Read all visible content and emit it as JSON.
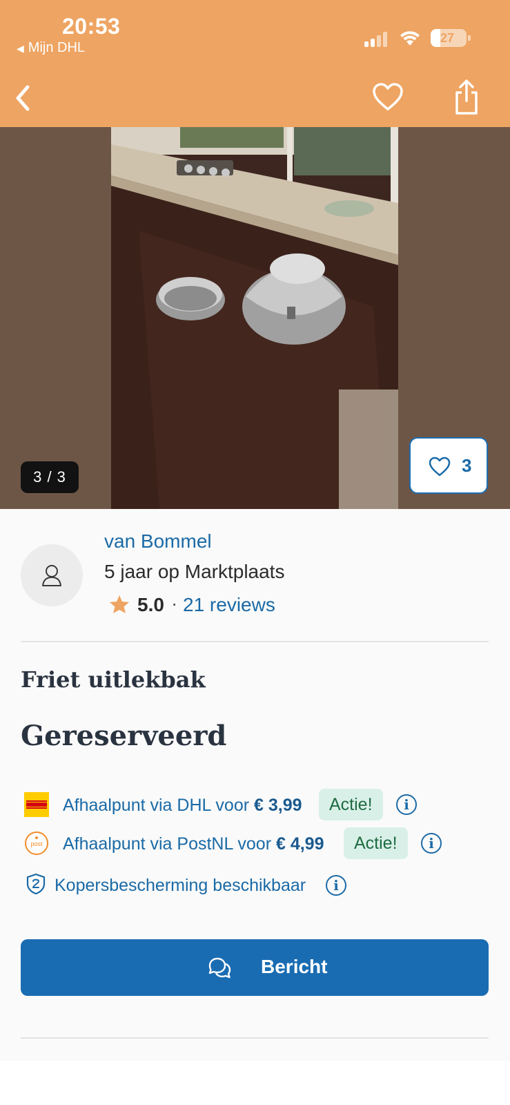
{
  "status_bar": {
    "time": "20:53",
    "back_app_label": "Mijn DHL",
    "battery": "27"
  },
  "header": {
    "back_icon": "chevron-left-icon",
    "favorite_icon": "heart-outline-icon",
    "share_icon": "share-icon",
    "bg_color": "#eea462"
  },
  "gallery": {
    "counter": "3 / 3",
    "favorites_count": "3"
  },
  "seller": {
    "name": "van Bommel",
    "years_label": "5 jaar op Marktplaats",
    "rating": "5.0",
    "separator": "·",
    "reviews": "21 reviews"
  },
  "listing": {
    "title": "Friet uitlekbak",
    "status": "Gereserveerd"
  },
  "shipping": [
    {
      "carrier_icon": "dhl-logo-icon",
      "text": "Afhaalpunt via DHL voor ",
      "price": "€ 3,99",
      "badge": "Actie!"
    },
    {
      "carrier_icon": "postnl-logo-icon",
      "text": "Afhaalpunt via PostNL voor ",
      "price": "€ 4,99",
      "badge": "Actie!"
    }
  ],
  "protection": {
    "icon": "shield-icon",
    "text": "Kopersbescherming beschikbaar"
  },
  "actions": {
    "message_label": "Bericht",
    "accent_color": "#1a6cb2"
  }
}
